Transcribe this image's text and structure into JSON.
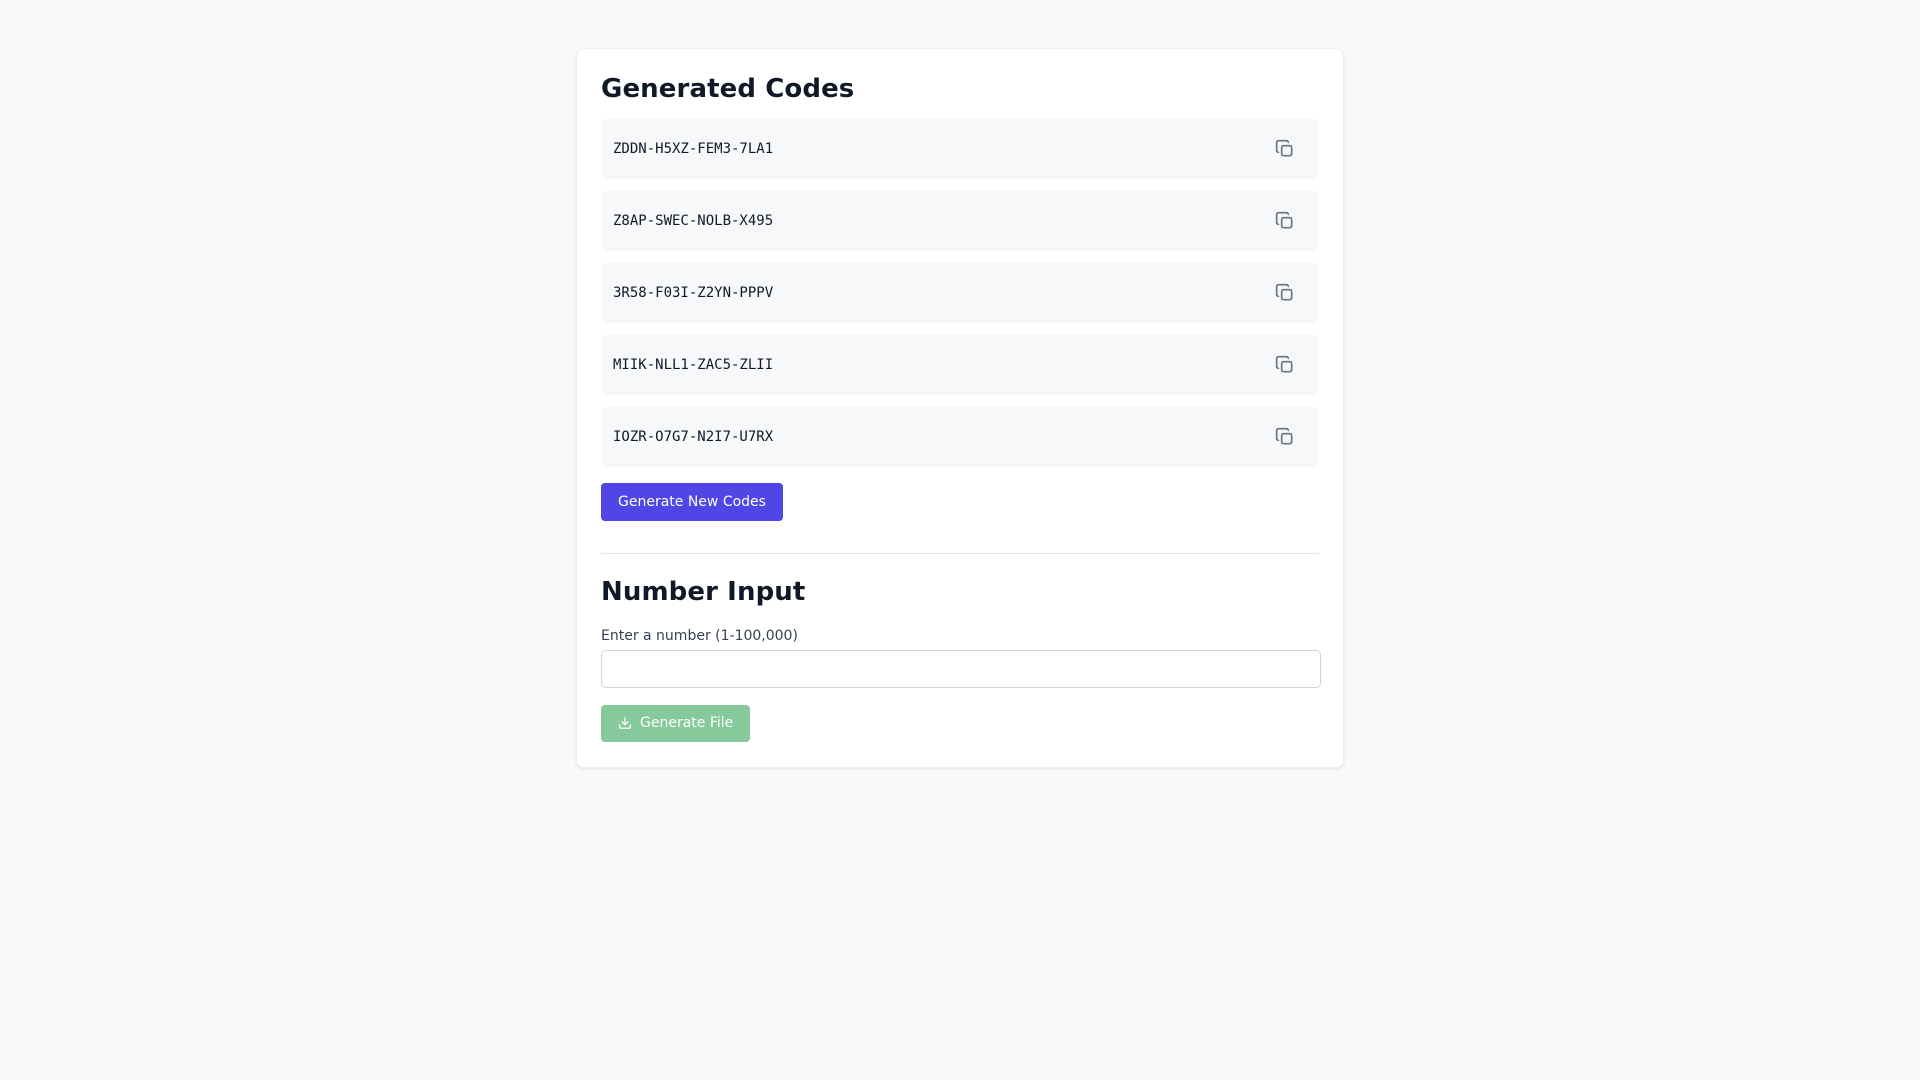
{
  "codes_section": {
    "title": "Generated Codes",
    "codes": [
      "ZDDN-H5XZ-FEM3-7LA1",
      "Z8AP-SWEC-NOLB-X495",
      "3R58-F03I-Z2YN-PPPV",
      "MIIK-NLL1-ZAC5-ZLII",
      "IOZR-O7G7-N2I7-U7RX"
    ],
    "copy_icon": "copy-icon",
    "generate_button_label": "Generate New Codes"
  },
  "number_section": {
    "title": "Number Input",
    "input_label": "Enter a number (1-100,000)",
    "input_value": "",
    "generate_file_label": "Generate File",
    "generate_file_icon": "download-icon"
  },
  "colors": {
    "page_background": "#f8f9fa",
    "primary_button": "#4f46e5",
    "disabled_success_button": "#86c99b",
    "code_row_background": "#f7f8f9"
  }
}
